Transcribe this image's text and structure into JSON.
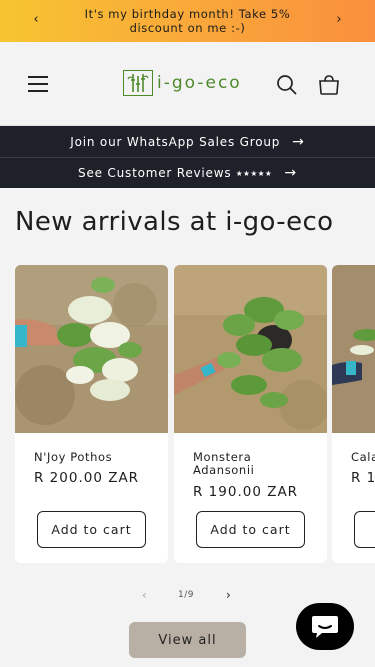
{
  "announcement": {
    "message": "It's my birthday month! Take 5% discount on me :-)",
    "prev_arrow": "‹",
    "next_arrow": "›"
  },
  "header": {
    "logo_text": "i-go-eco",
    "icons": [
      "menu-icon",
      "search-icon",
      "cart-icon"
    ]
  },
  "promo_bars": [
    {
      "label": "Join our WhatsApp Sales Group",
      "arrow": "→"
    },
    {
      "label": "See Customer Reviews ⭑⭑⭑⭑⭑",
      "arrow": "→"
    }
  ],
  "section": {
    "title": "New arrivals at i-go-eco"
  },
  "products": [
    {
      "name": "N'Joy Pothos",
      "price": "R 200.00 ZAR",
      "button": "Add to cart"
    },
    {
      "name": "Monstera Adansonii",
      "price": "R 190.00 ZAR",
      "button": "Add to cart"
    },
    {
      "name": "Cala",
      "price": "R 1",
      "button": "A"
    }
  ],
  "pagination": {
    "current": "1/9",
    "prev": "‹",
    "next": "›"
  },
  "view_all_label": "View all",
  "colors": {
    "announcement_gradient": [
      "#f7c531",
      "#f98f3d"
    ],
    "brand_green": "#4e8a2b",
    "dark_bar": "#1e2129",
    "view_all_bg": "#b9b0a5"
  }
}
